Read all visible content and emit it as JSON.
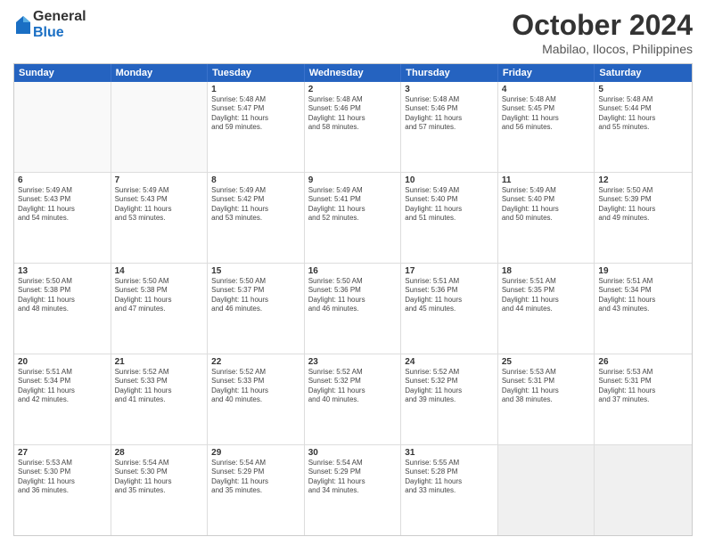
{
  "logo": {
    "general": "General",
    "blue": "Blue"
  },
  "title": "October 2024",
  "subtitle": "Mabilao, Ilocos, Philippines",
  "header_days": [
    "Sunday",
    "Monday",
    "Tuesday",
    "Wednesday",
    "Thursday",
    "Friday",
    "Saturday"
  ],
  "rows": [
    [
      {
        "day": "",
        "lines": []
      },
      {
        "day": "",
        "lines": []
      },
      {
        "day": "1",
        "lines": [
          "Sunrise: 5:48 AM",
          "Sunset: 5:47 PM",
          "Daylight: 11 hours",
          "and 59 minutes."
        ]
      },
      {
        "day": "2",
        "lines": [
          "Sunrise: 5:48 AM",
          "Sunset: 5:46 PM",
          "Daylight: 11 hours",
          "and 58 minutes."
        ]
      },
      {
        "day": "3",
        "lines": [
          "Sunrise: 5:48 AM",
          "Sunset: 5:46 PM",
          "Daylight: 11 hours",
          "and 57 minutes."
        ]
      },
      {
        "day": "4",
        "lines": [
          "Sunrise: 5:48 AM",
          "Sunset: 5:45 PM",
          "Daylight: 11 hours",
          "and 56 minutes."
        ]
      },
      {
        "day": "5",
        "lines": [
          "Sunrise: 5:48 AM",
          "Sunset: 5:44 PM",
          "Daylight: 11 hours",
          "and 55 minutes."
        ]
      }
    ],
    [
      {
        "day": "6",
        "lines": [
          "Sunrise: 5:49 AM",
          "Sunset: 5:43 PM",
          "Daylight: 11 hours",
          "and 54 minutes."
        ]
      },
      {
        "day": "7",
        "lines": [
          "Sunrise: 5:49 AM",
          "Sunset: 5:43 PM",
          "Daylight: 11 hours",
          "and 53 minutes."
        ]
      },
      {
        "day": "8",
        "lines": [
          "Sunrise: 5:49 AM",
          "Sunset: 5:42 PM",
          "Daylight: 11 hours",
          "and 53 minutes."
        ]
      },
      {
        "day": "9",
        "lines": [
          "Sunrise: 5:49 AM",
          "Sunset: 5:41 PM",
          "Daylight: 11 hours",
          "and 52 minutes."
        ]
      },
      {
        "day": "10",
        "lines": [
          "Sunrise: 5:49 AM",
          "Sunset: 5:40 PM",
          "Daylight: 11 hours",
          "and 51 minutes."
        ]
      },
      {
        "day": "11",
        "lines": [
          "Sunrise: 5:49 AM",
          "Sunset: 5:40 PM",
          "Daylight: 11 hours",
          "and 50 minutes."
        ]
      },
      {
        "day": "12",
        "lines": [
          "Sunrise: 5:50 AM",
          "Sunset: 5:39 PM",
          "Daylight: 11 hours",
          "and 49 minutes."
        ]
      }
    ],
    [
      {
        "day": "13",
        "lines": [
          "Sunrise: 5:50 AM",
          "Sunset: 5:38 PM",
          "Daylight: 11 hours",
          "and 48 minutes."
        ]
      },
      {
        "day": "14",
        "lines": [
          "Sunrise: 5:50 AM",
          "Sunset: 5:38 PM",
          "Daylight: 11 hours",
          "and 47 minutes."
        ]
      },
      {
        "day": "15",
        "lines": [
          "Sunrise: 5:50 AM",
          "Sunset: 5:37 PM",
          "Daylight: 11 hours",
          "and 46 minutes."
        ]
      },
      {
        "day": "16",
        "lines": [
          "Sunrise: 5:50 AM",
          "Sunset: 5:36 PM",
          "Daylight: 11 hours",
          "and 46 minutes."
        ]
      },
      {
        "day": "17",
        "lines": [
          "Sunrise: 5:51 AM",
          "Sunset: 5:36 PM",
          "Daylight: 11 hours",
          "and 45 minutes."
        ]
      },
      {
        "day": "18",
        "lines": [
          "Sunrise: 5:51 AM",
          "Sunset: 5:35 PM",
          "Daylight: 11 hours",
          "and 44 minutes."
        ]
      },
      {
        "day": "19",
        "lines": [
          "Sunrise: 5:51 AM",
          "Sunset: 5:34 PM",
          "Daylight: 11 hours",
          "and 43 minutes."
        ]
      }
    ],
    [
      {
        "day": "20",
        "lines": [
          "Sunrise: 5:51 AM",
          "Sunset: 5:34 PM",
          "Daylight: 11 hours",
          "and 42 minutes."
        ]
      },
      {
        "day": "21",
        "lines": [
          "Sunrise: 5:52 AM",
          "Sunset: 5:33 PM",
          "Daylight: 11 hours",
          "and 41 minutes."
        ]
      },
      {
        "day": "22",
        "lines": [
          "Sunrise: 5:52 AM",
          "Sunset: 5:33 PM",
          "Daylight: 11 hours",
          "and 40 minutes."
        ]
      },
      {
        "day": "23",
        "lines": [
          "Sunrise: 5:52 AM",
          "Sunset: 5:32 PM",
          "Daylight: 11 hours",
          "and 40 minutes."
        ]
      },
      {
        "day": "24",
        "lines": [
          "Sunrise: 5:52 AM",
          "Sunset: 5:32 PM",
          "Daylight: 11 hours",
          "and 39 minutes."
        ]
      },
      {
        "day": "25",
        "lines": [
          "Sunrise: 5:53 AM",
          "Sunset: 5:31 PM",
          "Daylight: 11 hours",
          "and 38 minutes."
        ]
      },
      {
        "day": "26",
        "lines": [
          "Sunrise: 5:53 AM",
          "Sunset: 5:31 PM",
          "Daylight: 11 hours",
          "and 37 minutes."
        ]
      }
    ],
    [
      {
        "day": "27",
        "lines": [
          "Sunrise: 5:53 AM",
          "Sunset: 5:30 PM",
          "Daylight: 11 hours",
          "and 36 minutes."
        ]
      },
      {
        "day": "28",
        "lines": [
          "Sunrise: 5:54 AM",
          "Sunset: 5:30 PM",
          "Daylight: 11 hours",
          "and 35 minutes."
        ]
      },
      {
        "day": "29",
        "lines": [
          "Sunrise: 5:54 AM",
          "Sunset: 5:29 PM",
          "Daylight: 11 hours",
          "and 35 minutes."
        ]
      },
      {
        "day": "30",
        "lines": [
          "Sunrise: 5:54 AM",
          "Sunset: 5:29 PM",
          "Daylight: 11 hours",
          "and 34 minutes."
        ]
      },
      {
        "day": "31",
        "lines": [
          "Sunrise: 5:55 AM",
          "Sunset: 5:28 PM",
          "Daylight: 11 hours",
          "and 33 minutes."
        ]
      },
      {
        "day": "",
        "lines": []
      },
      {
        "day": "",
        "lines": []
      }
    ]
  ]
}
